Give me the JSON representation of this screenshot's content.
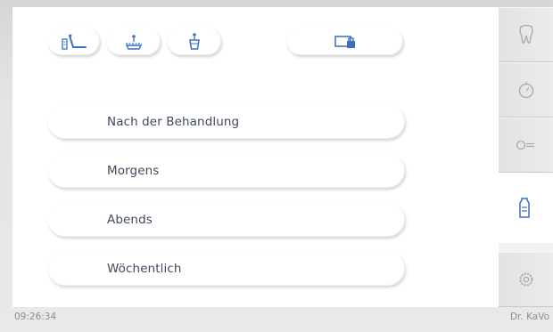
{
  "top_controls": [
    {
      "name": "chair-position-button",
      "icon": "dental-chair-icon"
    },
    {
      "name": "spittoon-position-button",
      "icon": "spittoon-icon"
    },
    {
      "name": "cup-filler-button",
      "icon": "cup-filler-icon"
    },
    {
      "name": "lock-screen-button",
      "icon": "screen-lock-icon"
    }
  ],
  "programs": [
    {
      "label": "Nach der Behandlung"
    },
    {
      "label": "Morgens"
    },
    {
      "label": "Abends"
    },
    {
      "label": "Wöchentlich"
    }
  ],
  "side_tabs": [
    {
      "icon": "tooth-icon",
      "active": false
    },
    {
      "icon": "timer-icon",
      "active": false
    },
    {
      "icon": "instrument-icon",
      "active": false
    },
    {
      "icon": "hygiene-bottle-icon",
      "active": true
    },
    {
      "icon": "settings-gear-icon",
      "active": false
    }
  ],
  "status_bar": {
    "time": "09:26:34",
    "user": "Dr. KaVo"
  },
  "colors": {
    "accent": "#3a6fbf",
    "text": "#3f4a5c",
    "icon_gray": "#a8a8a8"
  }
}
